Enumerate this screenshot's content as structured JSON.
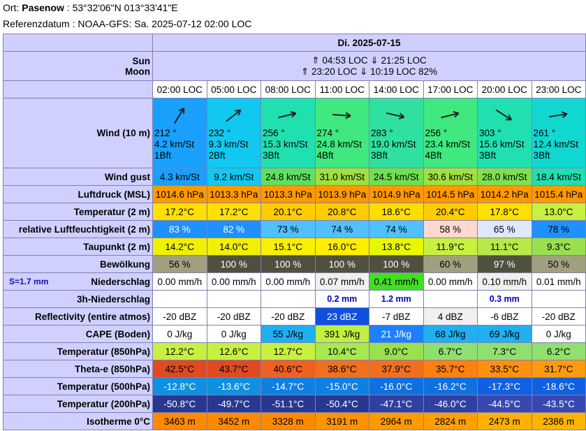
{
  "header": {
    "ort_label": "Ort:",
    "place": "Pasenow",
    "coords": "53°32'06\"N 013°33'41\"E",
    "ref": "Referenzdatum : NOAA-GFS: Sa. 2025-07-12 02:00 LOC"
  },
  "date": "Di. 2025-07-15",
  "sun_label": "Sun",
  "moon_label": "Moon",
  "sun_text": "⇑ 04:53 LOC ⇓ 21:25 LOC",
  "moon_text": "⇑ 23:20 LOC ⇓ 10:19 LOC  82%",
  "times": [
    "02:00 LOC",
    "05:00 LOC",
    "08:00 LOC",
    "11:00 LOC",
    "14:00 LOC",
    "17:00 LOC",
    "20:00 LOC",
    "23:00 LOC"
  ],
  "wind": {
    "label": "Wind (10 m)",
    "dir": [
      "212 °",
      "232 °",
      "256 °",
      "274 °",
      "283 °",
      "256 °",
      "303 °",
      "261 °"
    ],
    "deg": [
      212,
      232,
      256,
      274,
      283,
      256,
      303,
      261
    ],
    "speed": [
      "4.2  km/St",
      "9.3  km/St",
      "15.3  km/St",
      "24.8  km/St",
      "19.0  km/St",
      "23.4  km/St",
      "15.6  km/St",
      "12.4  km/St"
    ],
    "bft": [
      "1Bft",
      "2Bft",
      "3Bft",
      "4Bft",
      "3Bft",
      "4Bft",
      "3Bft",
      "3Bft"
    ],
    "colors": [
      "#1aa0ff",
      "#10c8f0",
      "#20e0b0",
      "#40e880",
      "#30e0a0",
      "#40e880",
      "#20e0b0",
      "#10d8d0"
    ]
  },
  "rows": [
    {
      "label": "Wind gust",
      "values": [
        "4.3  km/St",
        "9.2  km/St",
        "24.8  km/St",
        "31.0  km/St",
        "24.5  km/St",
        "30.6  km/St",
        "28.0  km/St",
        "18.4  km/St"
      ],
      "bg": [
        "#1aa0ff",
        "#10c8f0",
        "#60e060",
        "#a0e040",
        "#70e050",
        "#a0e040",
        "#80e050",
        "#20e0b0"
      ],
      "fg": [
        "#000",
        "#000",
        "#000",
        "#000",
        "#000",
        "#000",
        "#000",
        "#000"
      ]
    },
    {
      "label": "Luftdruck (MSL)",
      "values": [
        "1014.6 hPa",
        "1013.3 hPa",
        "1013.3 hPa",
        "1013.9 hPa",
        "1014.9 hPa",
        "1014.5 hPa",
        "1014.2 hPa",
        "1015.4 hPa"
      ],
      "bg": [
        "#ff9900",
        "#ff9900",
        "#ff9900",
        "#ff9900",
        "#ff9900",
        "#ff9900",
        "#ff9900",
        "#ff9900"
      ],
      "fg": [
        "#000",
        "#000",
        "#000",
        "#000",
        "#000",
        "#000",
        "#000",
        "#000"
      ]
    },
    {
      "label": "Temperatur (2 m)",
      "values": [
        "17.2°C",
        "17.2°C",
        "20.1°C",
        "20.8°C",
        "18.6°C",
        "20.4°C",
        "17.8°C",
        "13.0°C"
      ],
      "bg": [
        "#ffe000",
        "#ffe000",
        "#ffcc00",
        "#ffcc00",
        "#ffdd00",
        "#ffcc00",
        "#ffe000",
        "#c8f040"
      ],
      "fg": [
        "#000",
        "#000",
        "#000",
        "#000",
        "#000",
        "#000",
        "#000",
        "#000"
      ]
    },
    {
      "label": "relative Luftfeuchtigkeit (2 m)",
      "values": [
        "83 %",
        "82 %",
        "73 %",
        "74 %",
        "74 %",
        "58 %",
        "65 %",
        "78 %"
      ],
      "bg": [
        "#1e90ff",
        "#1e90ff",
        "#50c0ff",
        "#50c0ff",
        "#50c0ff",
        "#ffd8d0",
        "#e0e8ff",
        "#1e90ff"
      ],
      "fg": [
        "#fff",
        "#fff",
        "#000",
        "#000",
        "#000",
        "#000",
        "#000",
        "#000"
      ]
    },
    {
      "label": "Taupunkt (2 m)",
      "values": [
        "14.2°C",
        "14.0°C",
        "15.1°C",
        "16.0°C",
        "13.8°C",
        "11.9°C",
        "11.1°C",
        "9.3°C"
      ],
      "bg": [
        "#f0f000",
        "#f0f000",
        "#f8f000",
        "#ffee00",
        "#e8f800",
        "#c8f040",
        "#b8e848",
        "#98e050"
      ],
      "fg": [
        "#000",
        "#000",
        "#000",
        "#000",
        "#000",
        "#000",
        "#000",
        "#000"
      ]
    },
    {
      "label": "Bewölkung",
      "values": [
        "56 %",
        "100 %",
        "100 %",
        "100 %",
        "100 %",
        "60 %",
        "97 %",
        "50 %"
      ],
      "bg": [
        "#a0a080",
        "#505040",
        "#505040",
        "#505040",
        "#505040",
        "#a0a080",
        "#505040",
        "#a0a080"
      ],
      "fg": [
        "#000",
        "#fff",
        "#fff",
        "#fff",
        "#fff",
        "#000",
        "#fff",
        "#000"
      ]
    },
    {
      "label": "Niederschlag",
      "values": [
        "0.00 mm/h",
        "0.00 mm/h",
        "0.00 mm/h",
        "0.07 mm/h",
        "0.41 mm/h",
        "0.00 mm/h",
        "0.10 mm/h",
        "0.01 mm/h"
      ],
      "bg": [
        "#fff",
        "#fff",
        "#fff",
        "#f0f0f0",
        "#40e020",
        "#fff",
        "#f0f0f0",
        "#fff"
      ],
      "fg": [
        "#000",
        "#000",
        "#000",
        "#000",
        "#000",
        "#000",
        "#000",
        "#000"
      ]
    },
    {
      "label": "3h-Niederschlag",
      "values": [
        "",
        "",
        "",
        "0.2 mm",
        "1.2 mm",
        "",
        "0.3 mm",
        ""
      ],
      "bg": [
        "#fff",
        "#fff",
        "#fff",
        "#fff",
        "#fff",
        "#fff",
        "#fff",
        "#fff"
      ],
      "fg": [
        "#0000c0",
        "#0000c0",
        "#0000c0",
        "#0000c0",
        "#0000c0",
        "#0000c0",
        "#0000c0",
        "#0000c0"
      ]
    },
    {
      "label": "Reflectivity (entire atmos)",
      "values": [
        "-20 dBZ",
        "-20 dBZ",
        "-20 dBZ",
        "23 dBZ",
        "-7 dBZ",
        "4 dBZ",
        "-6 dBZ",
        "-20 dBZ"
      ],
      "bg": [
        "#fff",
        "#fff",
        "#fff",
        "#1050e0",
        "#fff",
        "#f0f0f0",
        "#fff",
        "#fff"
      ],
      "fg": [
        "#000",
        "#000",
        "#000",
        "#fff",
        "#000",
        "#000",
        "#000",
        "#000"
      ]
    },
    {
      "label": "CAPE (Boden)",
      "values": [
        "0 J/kg",
        "0 J/kg",
        "55 J/kg",
        "391 J/kg",
        "21 J/kg",
        "68 J/kg",
        "69 J/kg",
        "0 J/kg"
      ],
      "bg": [
        "#fff",
        "#fff",
        "#20b0f0",
        "#c0f040",
        "#1e80ff",
        "#20b0f0",
        "#20b0f0",
        "#fff"
      ],
      "fg": [
        "#000",
        "#000",
        "#000",
        "#000",
        "#fff",
        "#000",
        "#000",
        "#000"
      ]
    },
    {
      "label": "Temperatur (850hPa)",
      "values": [
        "12.2°C",
        "12.6°C",
        "12.7°C",
        "10.4°C",
        "9.0°C",
        "6.7°C",
        "7.3°C",
        "6.2°C"
      ],
      "bg": [
        "#c8f040",
        "#c8f040",
        "#c8f040",
        "#a8e850",
        "#98e050",
        "#90e070",
        "#90e070",
        "#90e070"
      ],
      "fg": [
        "#000",
        "#000",
        "#000",
        "#000",
        "#000",
        "#000",
        "#000",
        "#000"
      ]
    },
    {
      "label": "Theta-e (850hPa)",
      "values": [
        "42.5°C",
        "43.7°C",
        "40.6°C",
        "38.6°C",
        "37.9°C",
        "35.7°C",
        "33.5°C",
        "31.7°C"
      ],
      "bg": [
        "#e04a20",
        "#e04a20",
        "#f06020",
        "#f07020",
        "#f07020",
        "#ff8010",
        "#ff9010",
        "#ff9a10"
      ],
      "fg": [
        "#000",
        "#000",
        "#000",
        "#000",
        "#000",
        "#000",
        "#000",
        "#000"
      ]
    },
    {
      "label": "Temperatur (500hPa)",
      "values": [
        "-12.8°C",
        "-13.6°C",
        "-14.7°C",
        "-15.0°C",
        "-16.0°C",
        "-16.2°C",
        "-17.3°C",
        "-18.6°C"
      ],
      "bg": [
        "#1090e0",
        "#1090e0",
        "#1080e0",
        "#1080e0",
        "#1070e0",
        "#1070e0",
        "#1060e0",
        "#1060e0"
      ],
      "fg": [
        "#fff",
        "#fff",
        "#fff",
        "#fff",
        "#fff",
        "#fff",
        "#fff",
        "#fff"
      ]
    },
    {
      "label": "Temperatur (200hPa)",
      "values": [
        "-50.8°C",
        "-49.7°C",
        "-51.1°C",
        "-50.4°C",
        "-47.1°C",
        "-46.0°C",
        "-44.5°C",
        "-43.5°C"
      ],
      "bg": [
        "#283890",
        "#283890",
        "#283890",
        "#283890",
        "#3040a0",
        "#3040a0",
        "#3848b0",
        "#3848b0"
      ],
      "fg": [
        "#fff",
        "#fff",
        "#fff",
        "#fff",
        "#fff",
        "#fff",
        "#fff",
        "#fff"
      ]
    },
    {
      "label": "Isotherme 0°C",
      "values": [
        "3463 m",
        "3452 m",
        "3328 m",
        "3191 m",
        "2964 m",
        "2824 m",
        "2473 m",
        "2386 m"
      ],
      "bg": [
        "#ff8a00",
        "#ff8a00",
        "#ff8a00",
        "#ff9400",
        "#ff9a00",
        "#ffa000",
        "#ffb000",
        "#ffb400"
      ],
      "fg": [
        "#000",
        "#000",
        "#000",
        "#000",
        "#000",
        "#000",
        "#000",
        "#000"
      ]
    }
  ],
  "s_label": "S=1.7 mm"
}
